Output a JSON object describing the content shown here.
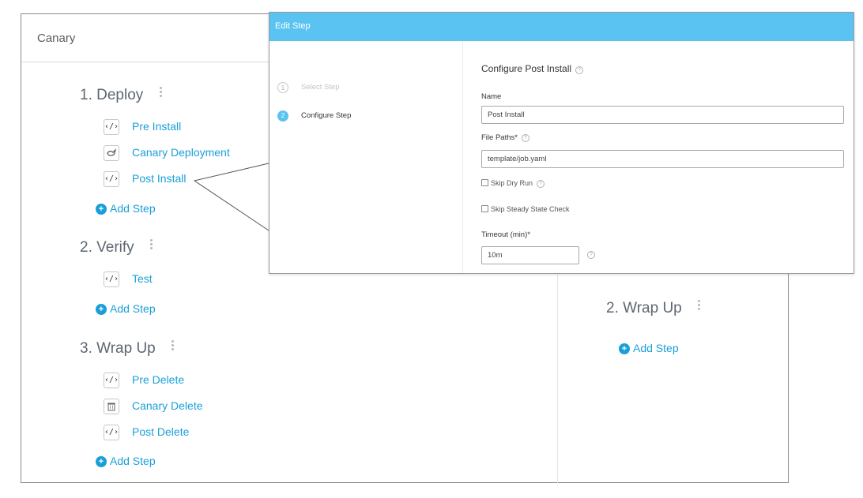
{
  "workflow": {
    "title": "Canary",
    "sections": [
      {
        "title": "1. Deploy",
        "steps": [
          {
            "label": "Pre Install",
            "icon": "code-icon"
          },
          {
            "label": "Canary Deployment",
            "icon": "bird-icon"
          },
          {
            "label": "Post Install",
            "icon": "code-icon"
          }
        ],
        "add_label": "Add Step"
      },
      {
        "title": "2. Verify",
        "steps": [
          {
            "label": "Test",
            "icon": "code-icon"
          }
        ],
        "add_label": "Add Step"
      },
      {
        "title": "3. Wrap Up",
        "steps": [
          {
            "label": "Pre Delete",
            "icon": "code-icon"
          },
          {
            "label": "Canary Delete",
            "icon": "trash-icon"
          },
          {
            "label": "Post Delete",
            "icon": "code-icon"
          }
        ],
        "add_label": "Add Step"
      }
    ],
    "right_section": {
      "title": "2. Wrap Up",
      "add_label": "Add Step"
    }
  },
  "dialog": {
    "title": "Edit Step",
    "wizard_steps": [
      {
        "number": "1",
        "label": "Select Step",
        "active": false
      },
      {
        "number": "2",
        "label": "Configure Step",
        "active": true
      }
    ],
    "content_title": "Configure Post Install",
    "name_label": "Name",
    "name_value": "Post Install",
    "file_paths_label": "File Paths*",
    "file_paths_value": "template/job.yaml",
    "skip_dry_run_label": "Skip Dry Run",
    "skip_steady_state_label": "Skip Steady State Check",
    "timeout_label": "Timeout (min)*",
    "timeout_value": "10m"
  },
  "icons": {
    "code_glyph": "‹/›",
    "add_glyph": "+",
    "help_glyph": "?"
  },
  "colors": {
    "accent": "#1a9fd8",
    "dialog_header": "#5bc3f1"
  }
}
